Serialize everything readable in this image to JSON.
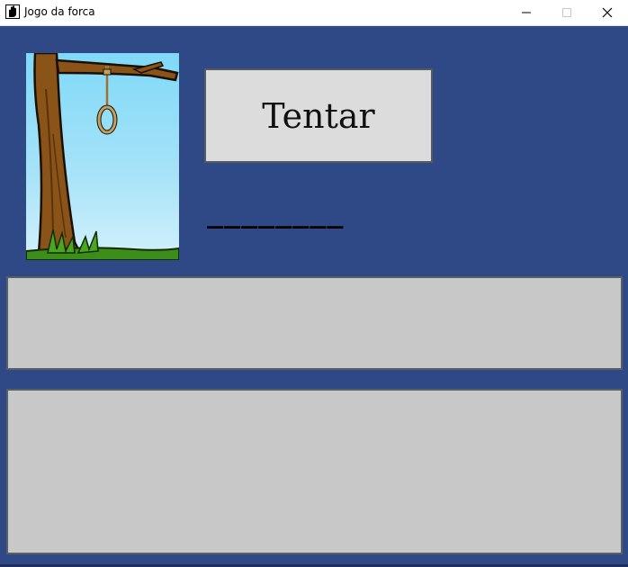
{
  "window": {
    "title": "Jogo da forca",
    "app_icon": "hand-icon",
    "controls": [
      "minimize-icon",
      "maximize-icon",
      "close-icon"
    ]
  },
  "game": {
    "try_button_label": "Tentar",
    "word_mask": "________",
    "image": "gallows-tree-noose",
    "guess_input_value": "",
    "history_text": ""
  },
  "colors": {
    "background": "#2f4886",
    "button_bg": "#dcdcdc",
    "panel_bg": "#c8c8c8",
    "border": "#5a5f66"
  }
}
